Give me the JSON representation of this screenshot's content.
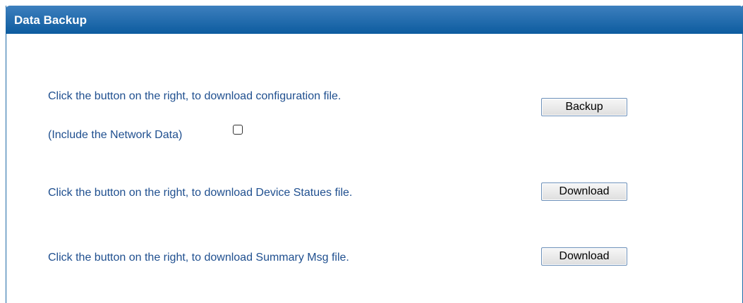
{
  "panel": {
    "title": "Data Backup"
  },
  "config": {
    "text": "Click the button on the right, to download configuration file.",
    "include_label": "(Include the Network Data)",
    "include_checked": false,
    "button_label": "Backup"
  },
  "device": {
    "text": "Click the button on the right, to download Device Statues file.",
    "button_label": "Download"
  },
  "summary": {
    "text": "Click the button on the right, to download Summary Msg file.",
    "button_label": "Download"
  }
}
